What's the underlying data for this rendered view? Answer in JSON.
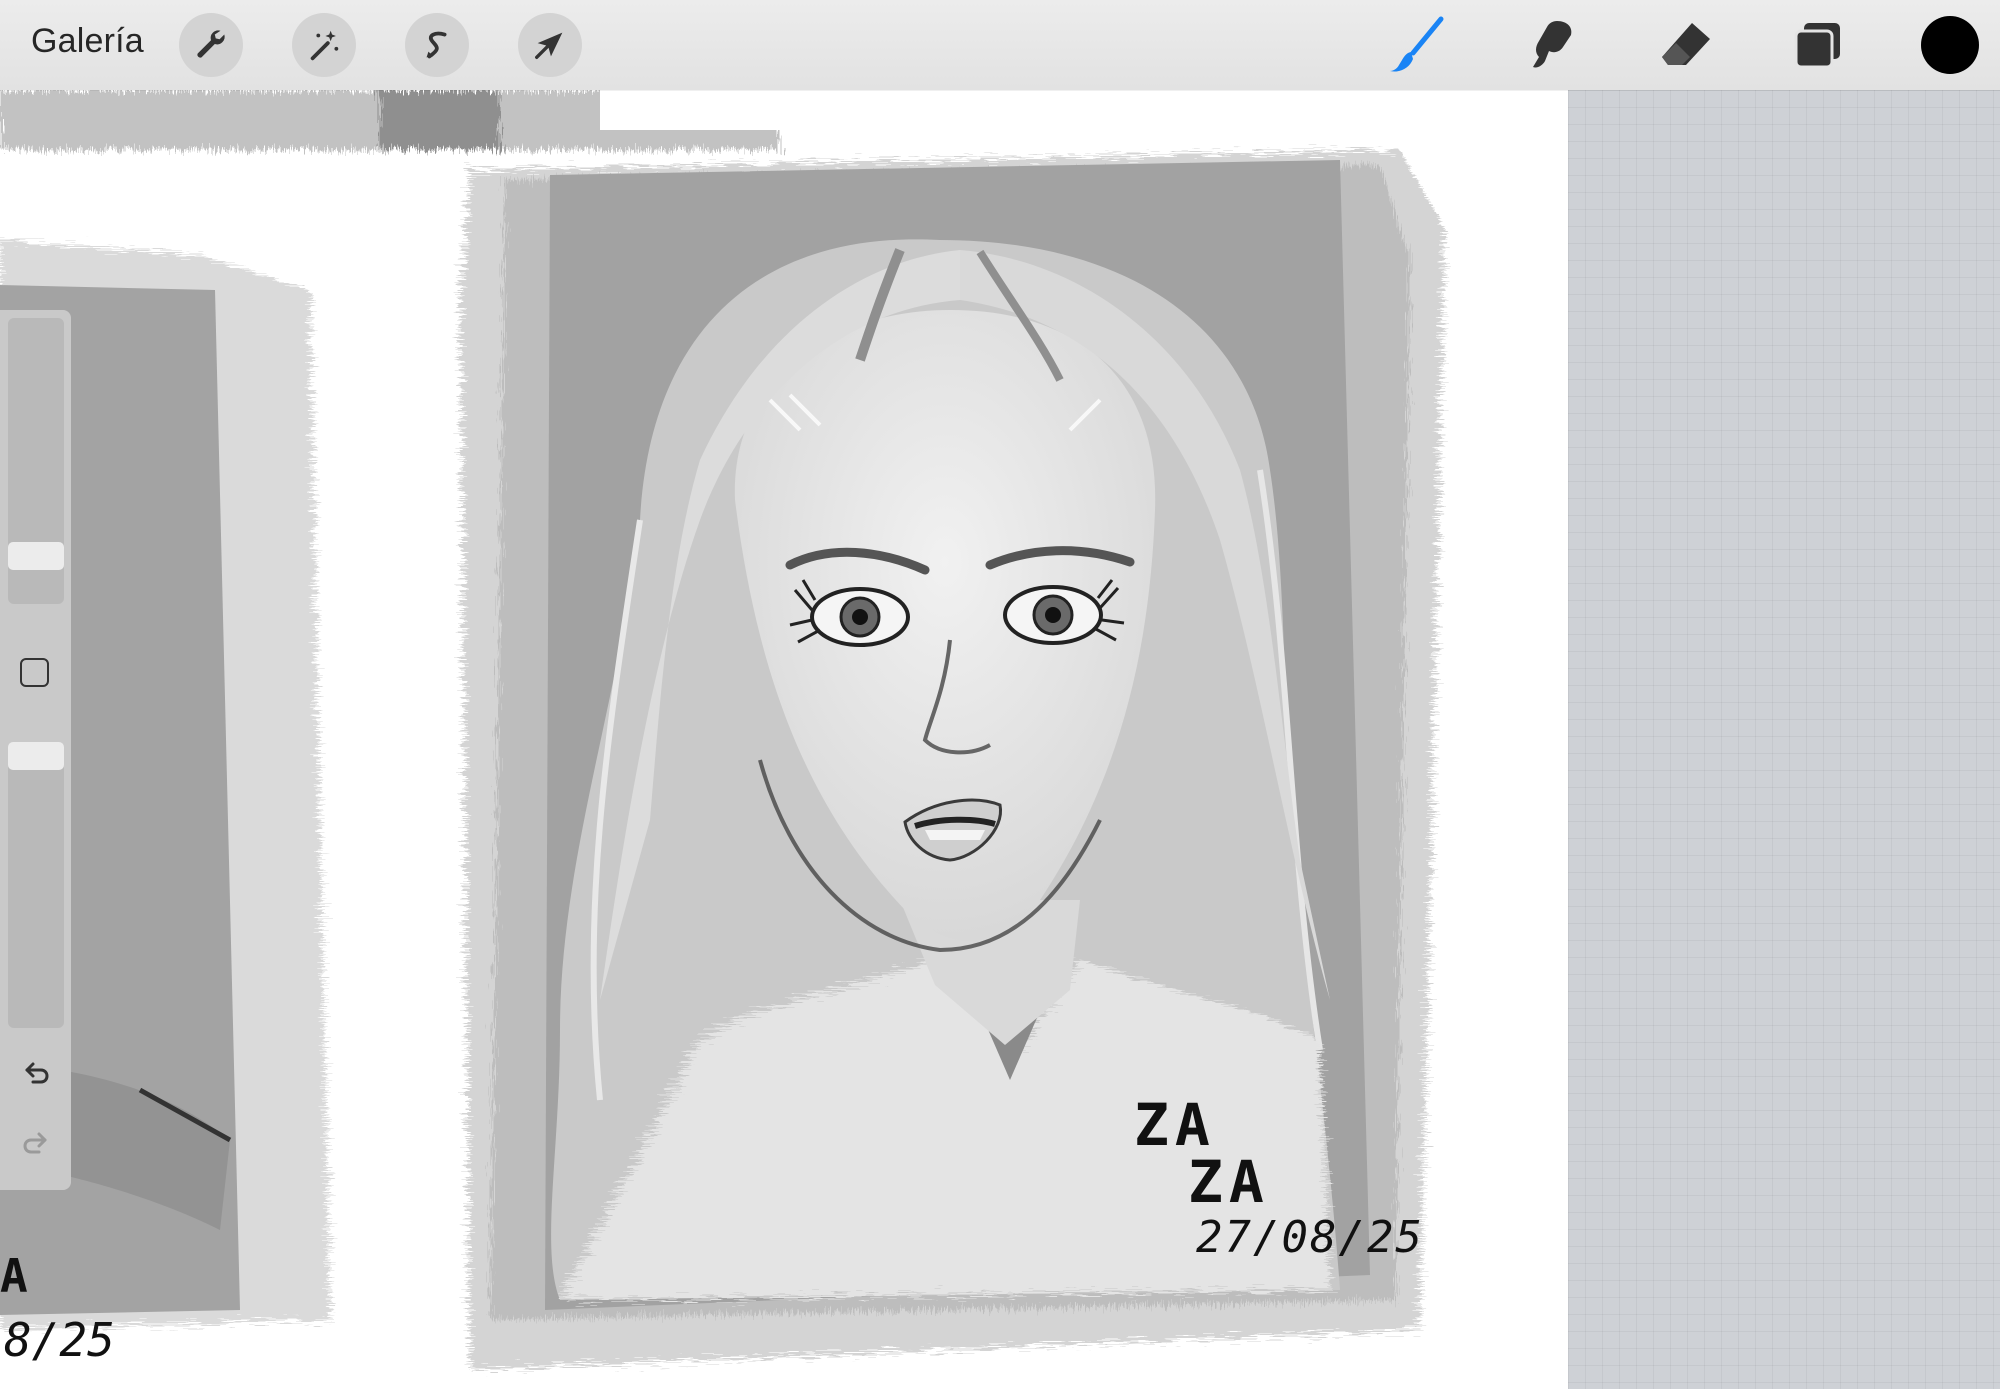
{
  "toolbar": {
    "gallery_label": "Galería",
    "left_tools": [
      {
        "name": "wrench-icon",
        "label": "Acciones"
      },
      {
        "name": "magic-wand-icon",
        "label": "Ajustes"
      },
      {
        "name": "selection-s-icon",
        "label": "Selección"
      },
      {
        "name": "transform-arrow-icon",
        "label": "Transformar"
      }
    ],
    "right_tools": [
      {
        "name": "brush-icon",
        "active": true,
        "active_color": "#1a84f5"
      },
      {
        "name": "smudge-icon",
        "active": false
      },
      {
        "name": "eraser-icon",
        "active": false
      },
      {
        "name": "layers-icon",
        "active": false
      }
    ],
    "current_color": "#000000"
  },
  "sidebar": {
    "brush_size_level": 0.2,
    "opacity_level": 1.0,
    "undo_icon": "undo-arrow-icon",
    "redo_icon": "redo-arrow-icon",
    "modify_icon": "square-modify-icon"
  },
  "artwork": {
    "signature_line1": "ZA",
    "signature_line2": "ZA",
    "date": "27/08/25",
    "partial_date_left": "8/25",
    "partial_letter_left": "A"
  },
  "colors": {
    "toolbar_bg": "#e6e6e6",
    "canvas_bg": "#ffffff",
    "grid_bg": "#ced1d6",
    "card_gray": "#a0a0a0",
    "sidebar_bg": "#c9c9c9"
  }
}
